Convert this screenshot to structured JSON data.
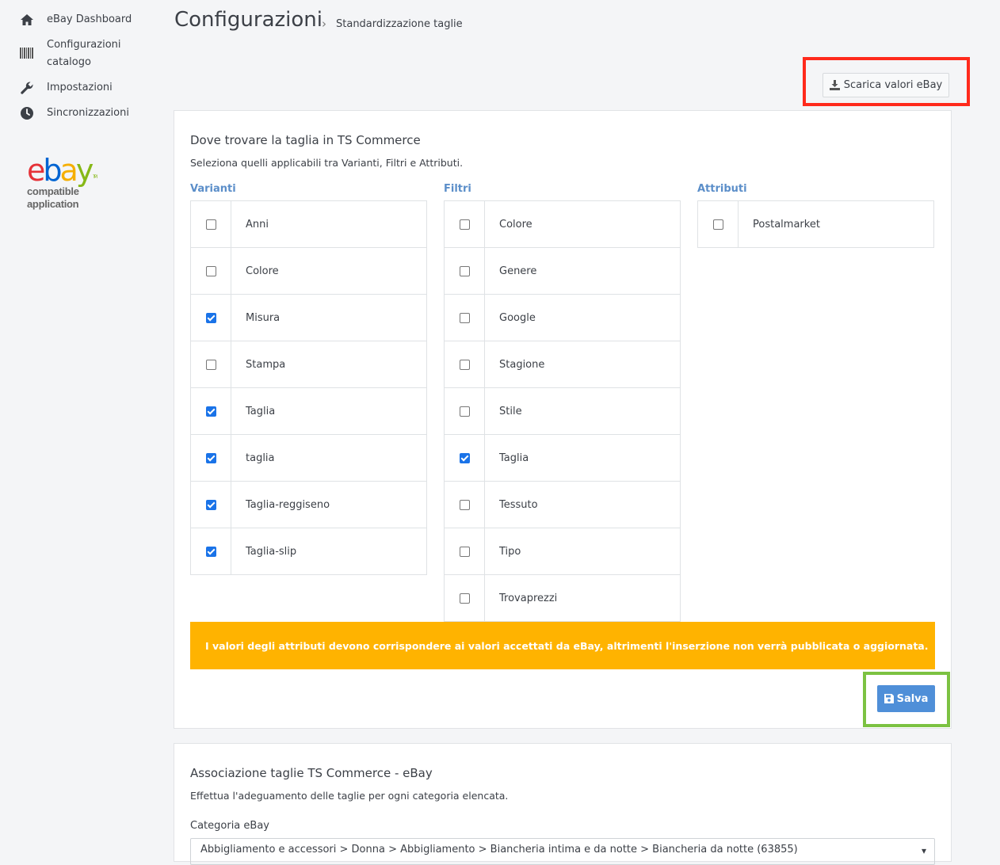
{
  "sidebar": {
    "items": [
      {
        "label": "eBay Dashboard",
        "icon": "home-icon"
      },
      {
        "label": "Configurazioni catalogo",
        "icon": "barcode-icon"
      },
      {
        "label": "Impostazioni",
        "icon": "wrench-icon"
      },
      {
        "label": "Sincronizzazioni",
        "icon": "clock-icon"
      }
    ],
    "logo": {
      "word": "ebay",
      "tm": "TM",
      "line1": "compatible",
      "line2": "application"
    }
  },
  "header": {
    "title": "Configurazioni",
    "separator": "›",
    "breadcrumb": "Standardizzazione taglie"
  },
  "toolbar": {
    "download_label": "Scarica valori eBay"
  },
  "size_source": {
    "title": "Dove trovare la taglia in TS Commerce",
    "subtitle": "Seleziona quelli applicabili tra Varianti, Filtri e Attributi.",
    "varianti_label": "Varianti",
    "filtri_label": "Filtri",
    "attributi_label": "Attributi",
    "varianti": [
      {
        "label": "Anni",
        "checked": false
      },
      {
        "label": "Colore",
        "checked": false
      },
      {
        "label": "Misura",
        "checked": true
      },
      {
        "label": "Stampa",
        "checked": false
      },
      {
        "label": "Taglia",
        "checked": true
      },
      {
        "label": "taglia",
        "checked": true
      },
      {
        "label": "Taglia-reggiseno",
        "checked": true
      },
      {
        "label": "Taglia-slip",
        "checked": true
      }
    ],
    "filtri": [
      {
        "label": "Colore",
        "checked": false
      },
      {
        "label": "Genere",
        "checked": false
      },
      {
        "label": "Google",
        "checked": false
      },
      {
        "label": "Stagione",
        "checked": false
      },
      {
        "label": "Stile",
        "checked": false
      },
      {
        "label": "Taglia",
        "checked": true
      },
      {
        "label": "Tessuto",
        "checked": false
      },
      {
        "label": "Tipo",
        "checked": false
      },
      {
        "label": "Trovaprezzi",
        "checked": false
      }
    ],
    "attributi": [
      {
        "label": "Postalmarket",
        "checked": false
      }
    ],
    "warning": "I valori degli attributi devono corrispondere ai valori accettati da eBay, altrimenti l'inserzione non verrà pubblicata o aggiornata.",
    "save_label": "Salva"
  },
  "association": {
    "title": "Associazione taglie TS Commerce - eBay",
    "subtitle": "Effettua l'adeguamento delle taglie per ogni categoria elencata.",
    "category_label": "Categoria eBay",
    "category_value": "Abbigliamento e accessori > Donna > Abbigliamento > Biancheria intima e da notte > Biancheria da notte (63855)"
  },
  "colors": {
    "accent": "#5b8ec9",
    "warning": "#ffb300",
    "save": "#4f8fd8",
    "highlight_red": "#ff2a1c",
    "highlight_green": "#7cc242"
  }
}
